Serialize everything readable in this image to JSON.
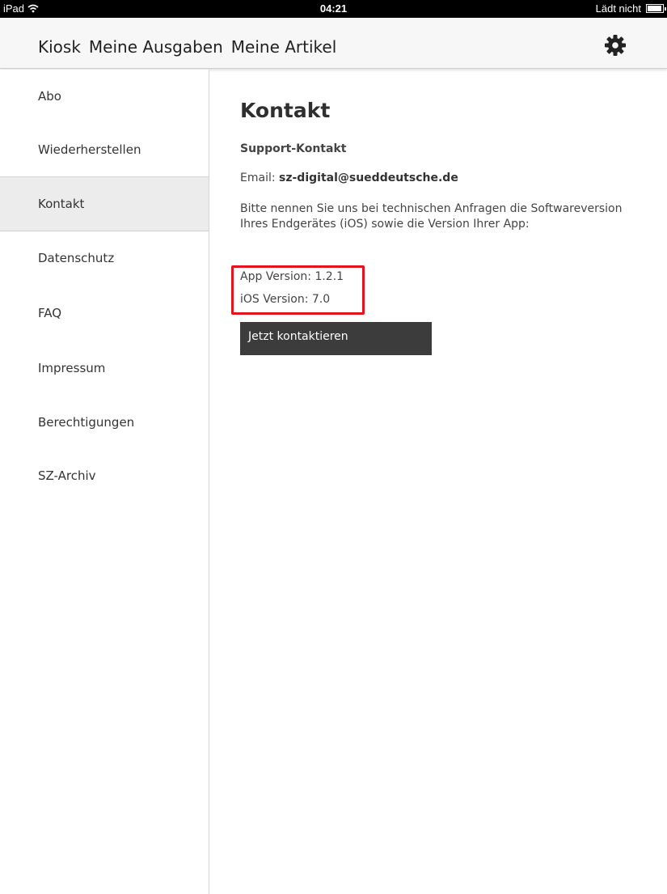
{
  "status_bar": {
    "device": "iPad",
    "time": "04:21",
    "charging_status": "Lädt nicht",
    "battery_level": 0.95
  },
  "nav": {
    "tabs": [
      "Kiosk",
      "Meine Ausgaben",
      "Meine Artikel"
    ],
    "settings_icon": "gear-icon"
  },
  "sidebar": {
    "items": [
      {
        "label": "Abo"
      },
      {
        "label": "Wiederherstellen"
      },
      {
        "label": "Kontakt",
        "active": true
      },
      {
        "label": "Datenschutz"
      },
      {
        "label": "FAQ"
      },
      {
        "label": "Impressum"
      },
      {
        "label": "Berechtigungen"
      },
      {
        "label": "SZ-Archiv"
      }
    ]
  },
  "content": {
    "title": "Kontakt",
    "subtitle": "Support-Kontakt",
    "email_label": "Email:",
    "email_value": "sz-digital@sueddeutsche.de",
    "description": "Bitte nennen Sie uns bei technischen Anfragen die Softwareversion Ihres Endgerätes (iOS) sowie die Version Ihrer App:",
    "app_version": "App Version: 1.2.1",
    "ios_version": "iOS Version: 7.0",
    "contact_button": "Jetzt kontaktieren"
  },
  "colors": {
    "highlight": "#e5131d",
    "button_bg": "#3c3c3c",
    "active_item_bg": "#ececec"
  }
}
